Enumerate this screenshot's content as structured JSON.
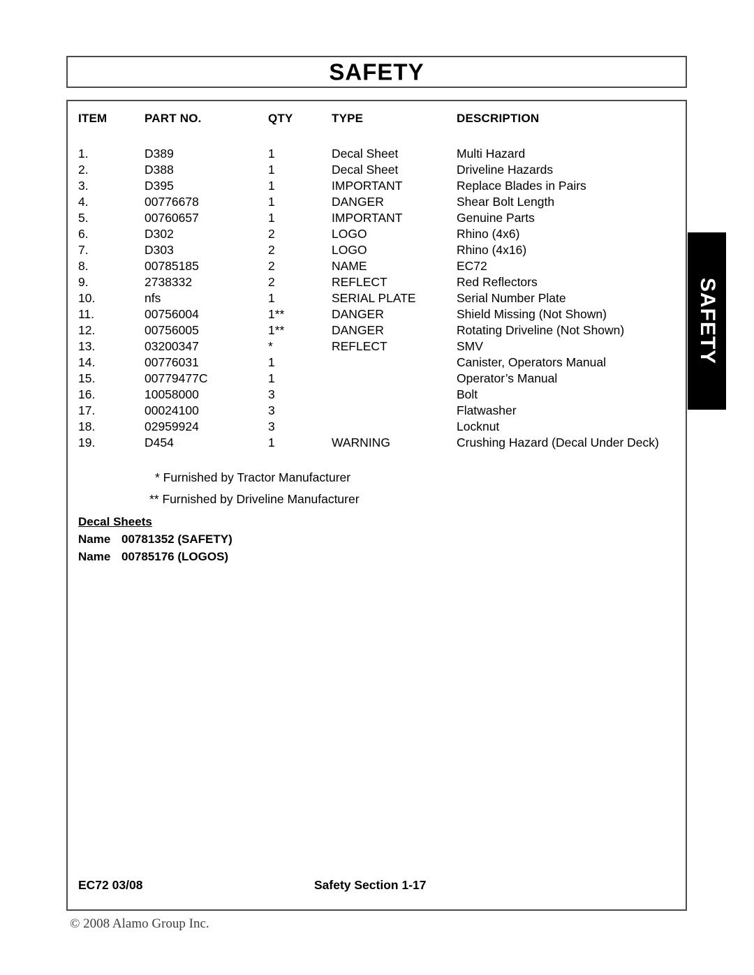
{
  "page": {
    "title": "SAFETY",
    "side_tab_label": "SAFETY"
  },
  "table": {
    "headers": {
      "item": "ITEM",
      "part_no": "PART NO.",
      "qty": "QTY",
      "type": "TYPE",
      "description": "DESCRIPTION"
    },
    "rows": [
      {
        "item": "1.",
        "part_no": "D389",
        "qty": "1",
        "type": "Decal Sheet",
        "description": "Multi Hazard"
      },
      {
        "item": "2.",
        "part_no": "D388",
        "qty": "1",
        "type": "Decal Sheet",
        "description": "Driveline Hazards"
      },
      {
        "item": "3.",
        "part_no": "D395",
        "qty": "1",
        "type": "IMPORTANT",
        "description": "Replace Blades in Pairs"
      },
      {
        "item": "4.",
        "part_no": "00776678",
        "qty": "1",
        "type": "DANGER",
        "description": "Shear Bolt Length"
      },
      {
        "item": "5.",
        "part_no": "00760657",
        "qty": "1",
        "type": "IMPORTANT",
        "description": "Genuine Parts"
      },
      {
        "item": "6.",
        "part_no": "D302",
        "qty": "2",
        "type": "LOGO",
        "description": "Rhino (4x6)"
      },
      {
        "item": "7.",
        "part_no": "D303",
        "qty": "2",
        "type": "LOGO",
        "description": "Rhino (4x16)"
      },
      {
        "item": "8.",
        "part_no": "00785185",
        "qty": "2",
        "type": "NAME",
        "description": "EC72"
      },
      {
        "item": "9.",
        "part_no": "2738332",
        "qty": "2",
        "type": "REFLECT",
        "description": "Red Reflectors"
      },
      {
        "item": "10.",
        "part_no": "nfs",
        "qty": "1",
        "type": "SERIAL PLATE",
        "description": "Serial Number Plate"
      },
      {
        "item": "11.",
        "part_no": "00756004",
        "qty": "1**",
        "type": "DANGER",
        "description": "Shield Missing (Not Shown)"
      },
      {
        "item": "12.",
        "part_no": "00756005",
        "qty": "1**",
        "type": "DANGER",
        "description": "Rotating Driveline (Not Shown)"
      },
      {
        "item": "13.",
        "part_no": "03200347",
        "qty": "*",
        "type": "REFLECT",
        "description": "SMV"
      },
      {
        "item": "14.",
        "part_no": "00776031",
        "qty": "1",
        "type": "",
        "description": "Canister, Operators Manual"
      },
      {
        "item": "15.",
        "part_no": "00779477C",
        "qty": "1",
        "type": "",
        "description": "Operator’s Manual"
      },
      {
        "item": "16.",
        "part_no": "10058000",
        "qty": "3",
        "type": "",
        "description": "Bolt"
      },
      {
        "item": "17.",
        "part_no": "00024100",
        "qty": "3",
        "type": "",
        "description": "Flatwasher"
      },
      {
        "item": "18.",
        "part_no": "02959924",
        "qty": "3",
        "type": "",
        "description": "Locknut"
      },
      {
        "item": "19.",
        "part_no": "D454",
        "qty": "1",
        "type": "WARNING",
        "description": "Crushing Hazard (Decal Under Deck)"
      }
    ]
  },
  "footnotes": {
    "single_star": "* Furnished by Tractor Manufacturer",
    "double_star": "** Furnished by Driveline Manufacturer"
  },
  "decal_sheets": {
    "heading": "Decal Sheets",
    "lines": [
      {
        "label": "Name",
        "value": "00781352 (SAFETY)"
      },
      {
        "label": "Name",
        "value": "00785176 (LOGOS)"
      }
    ]
  },
  "footer": {
    "left": "EC72   03/08",
    "center": "Safety Section 1-17",
    "copyright": "© 2008 Alamo Group Inc."
  }
}
